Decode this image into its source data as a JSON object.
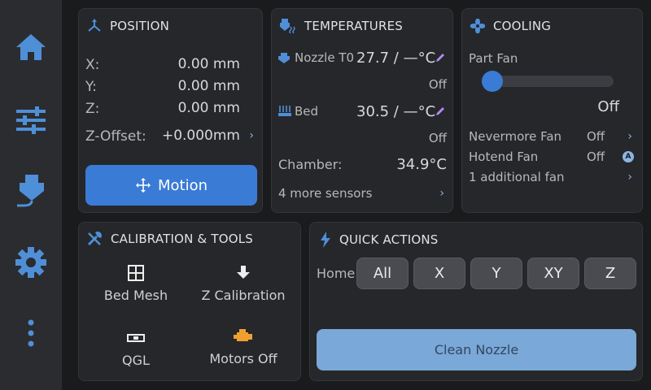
{
  "sidebar": {
    "items": [
      {
        "name": "home-icon"
      },
      {
        "name": "tune-icon"
      },
      {
        "name": "filament-icon"
      },
      {
        "name": "gear-icon"
      },
      {
        "name": "more-vertical-icon"
      }
    ]
  },
  "position": {
    "title": "POSITION",
    "x_label": "X:",
    "x_value": "0.00 mm",
    "y_label": "Y:",
    "y_value": "0.00 mm",
    "z_label": "Z:",
    "z_value": "0.00 mm",
    "zoffset_label": "Z-Offset:",
    "zoffset_value": "+0.000mm",
    "motion_label": "Motion"
  },
  "temperatures": {
    "title": "TEMPERATURES",
    "nozzle_label": "Nozzle T0",
    "nozzle_value": "27.7 / —°C",
    "nozzle_status": "Off",
    "bed_label": "Bed",
    "bed_value": "30.5 / —°C",
    "bed_status": "Off",
    "chamber_label": "Chamber:",
    "chamber_value": "34.9°C",
    "more_label": "4 more sensors"
  },
  "cooling": {
    "title": "COOLING",
    "part_fan_label": "Part Fan",
    "part_fan_value": "Off",
    "part_fan_level": 0,
    "nevermore_label": "Nevermore Fan",
    "nevermore_value": "Off",
    "hotend_label": "Hotend Fan",
    "hotend_value": "Off",
    "hotend_badge": "A",
    "additional_label": "1 additional fan"
  },
  "calibration": {
    "title": "CALIBRATION & TOOLS",
    "bed_mesh": "Bed Mesh",
    "z_calibration": "Z Calibration",
    "qgl": "QGL",
    "motors_off": "Motors Off"
  },
  "quick_actions": {
    "title": "QUICK ACTIONS",
    "home_label": "Home",
    "home_all": "All",
    "home_x": "X",
    "home_y": "Y",
    "home_xy": "XY",
    "home_z": "Z",
    "clean_nozzle": "Clean Nozzle"
  },
  "colors": {
    "accent": "#3a7bd5",
    "icon_blue": "#4f8fd8",
    "warning_orange": "#f0a030",
    "clean_button": "#7aa8d8"
  }
}
